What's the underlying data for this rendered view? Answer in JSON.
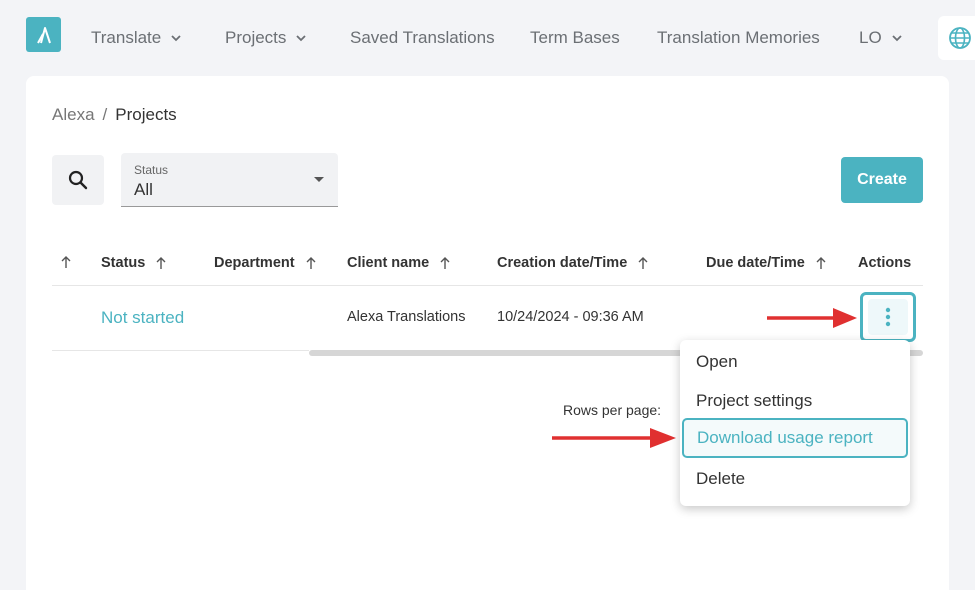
{
  "nav": {
    "items": [
      {
        "label": "Translate",
        "has_dropdown": true
      },
      {
        "label": "Projects",
        "has_dropdown": true
      },
      {
        "label": "Saved Translations",
        "has_dropdown": false
      },
      {
        "label": "Term Bases",
        "has_dropdown": false
      },
      {
        "label": "Translation Memories",
        "has_dropdown": false
      },
      {
        "label": "LO",
        "has_dropdown": true
      }
    ],
    "logo_icon": "lambda-logo-icon",
    "globe_icon": "globe-icon"
  },
  "breadcrumb": {
    "root": "Alexa",
    "separator": "/",
    "current": "Projects"
  },
  "filters": {
    "status_label": "Status",
    "status_value": "All"
  },
  "toolbar": {
    "create_label": "Create"
  },
  "table": {
    "headers": {
      "status": "Status",
      "department": "Department",
      "client": "Client name",
      "created": "Creation date/Time",
      "due": "Due date/Time",
      "actions": "Actions"
    },
    "rows": [
      {
        "status": "Not started",
        "department": "",
        "client": "Alexa Translations",
        "created": "10/24/2024 - 09:36 AM",
        "due": ""
      }
    ]
  },
  "pagination": {
    "rows_per_page_label": "Rows per page:"
  },
  "actions_menu": {
    "items": [
      "Open",
      "Project settings",
      "Download usage report",
      "Delete"
    ],
    "highlighted": "Download usage report"
  },
  "colors": {
    "accent": "#4bb3c1",
    "annotation_arrow": "#e03030"
  }
}
